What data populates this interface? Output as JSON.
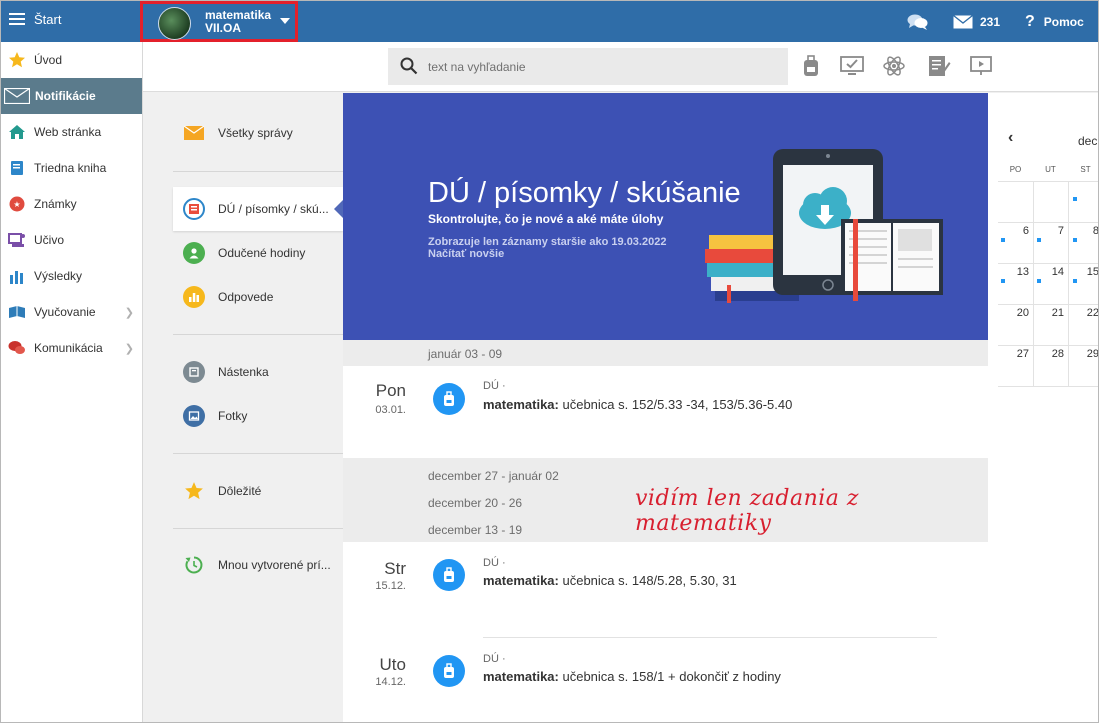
{
  "topbar": {
    "start_label": "Štart",
    "class_name_line1": "matematika",
    "class_name_line2": "VII.OA",
    "messages_count": "231",
    "help_label": "Pomoc"
  },
  "sidebar": {
    "items": [
      {
        "label": "Úvod",
        "icon": "star-icon"
      },
      {
        "label": "Notifikácie",
        "icon": "envelope-icon"
      },
      {
        "label": "Web stránka",
        "icon": "home-icon"
      },
      {
        "label": "Triedna kniha",
        "icon": "book-icon"
      },
      {
        "label": "Známky",
        "icon": "grades-icon"
      },
      {
        "label": "Učivo",
        "icon": "curriculum-icon"
      },
      {
        "label": "Výsledky",
        "icon": "bar-chart-icon"
      },
      {
        "label": "Vyučovanie",
        "icon": "teaching-icon"
      },
      {
        "label": "Komunikácia",
        "icon": "chat-icon"
      }
    ]
  },
  "search": {
    "placeholder": "text na vyhľadanie"
  },
  "midnav": {
    "items": [
      {
        "label": "Všetky správy"
      },
      {
        "label": "DÚ / písomky / skú..."
      },
      {
        "label": "Odučené hodiny"
      },
      {
        "label": "Odpovede"
      },
      {
        "label": "Nástenka"
      },
      {
        "label": "Fotky"
      },
      {
        "label": "Dôležité"
      },
      {
        "label": "Mnou vytvorené prí..."
      }
    ]
  },
  "hero": {
    "title": "DÚ / písomky / skúšanie",
    "subtitle": "Skontrolujte, čo je nové a aké máte úlohy",
    "note_line1": "Zobrazuje len záznamy staršie ako 19.03.2022",
    "note_line2": "Načítať novšie"
  },
  "weeks": {
    "w1": "január 03 - 09",
    "w2": "december 27 - január 02",
    "w3": "december 20 - 26",
    "w4": "december 13 - 19"
  },
  "entries": [
    {
      "day": "Pon",
      "date": "03.01.",
      "type": "DÚ ·",
      "subject": "matematika:",
      "text": " učebnica s. 152/5.33 -34, 153/5.36-5.40"
    },
    {
      "day": "Str",
      "date": "15.12.",
      "type": "DÚ ·",
      "subject": "matematika:",
      "text": " učebnica s. 148/5.28, 5.30, 31"
    },
    {
      "day": "Uto",
      "date": "14.12.",
      "type": "DÚ ·",
      "subject": "matematika:",
      "text": " učebnica s. 158/1 + dokončiť z hodiny"
    }
  ],
  "annotation": "vidím len zadania z matematiky",
  "calendar": {
    "month": "dec",
    "headers": [
      "PO",
      "UT",
      "ST"
    ],
    "rows": [
      [
        "",
        "",
        ""
      ],
      [
        "6",
        "7",
        "8"
      ],
      [
        "13",
        "14",
        "15"
      ],
      [
        "20",
        "21",
        "22"
      ],
      [
        "27",
        "28",
        "29"
      ]
    ]
  },
  "colors": {
    "topbar": "#2f6da8",
    "hero": "#3d51b4",
    "sidebar_active": "#5b7b8c",
    "accent_blue": "#2196f3",
    "annotation_red": "#d81f2f"
  }
}
